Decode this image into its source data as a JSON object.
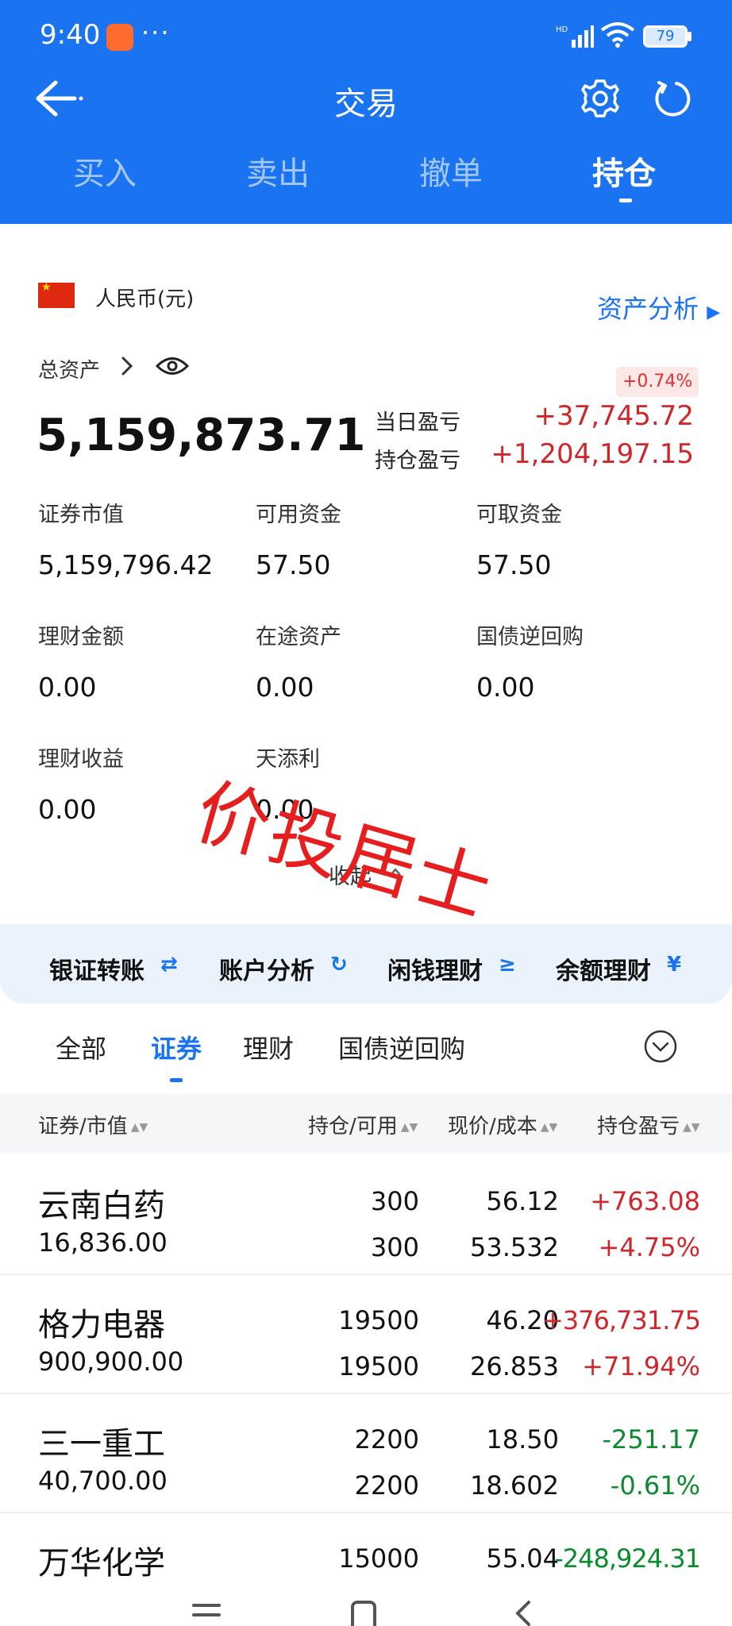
{
  "status_bar": {
    "time": "9:40",
    "dots": "···",
    "battery": "79"
  },
  "nav": {
    "title": "交易"
  },
  "tabs": [
    {
      "label": "买入"
    },
    {
      "label": "卖出"
    },
    {
      "label": "撤单"
    },
    {
      "label": "持仓",
      "active": true
    }
  ],
  "account": {
    "currency": "人民币(元)",
    "asset_analysis": "资产分析",
    "total_label": "总资产",
    "total_value": "5,159,873.71",
    "pct_badge": "+0.74%",
    "daily_pl_label": "当日盈亏",
    "daily_pl_value": "+37,745.72",
    "hold_pl_label": "持仓盈亏",
    "hold_pl_value": "+1,204,197.15",
    "grid": [
      {
        "label": "证券市值",
        "value": "5,159,796.42"
      },
      {
        "label": "可用资金",
        "value": "57.50"
      },
      {
        "label": "可取资金",
        "value": "57.50"
      },
      {
        "label": "理财金额",
        "value": "0.00"
      },
      {
        "label": "在途资产",
        "value": "0.00"
      },
      {
        "label": "国债逆回购",
        "value": "0.00"
      },
      {
        "label": "理财收益",
        "value": "0.00"
      },
      {
        "label": "天添利",
        "value": "0.00"
      }
    ],
    "collapse": "收起",
    "watermark": "价投居士"
  },
  "quick_actions": [
    {
      "label": "银证转账",
      "icon": "⇄"
    },
    {
      "label": "账户分析",
      "icon": "↻"
    },
    {
      "label": "闲钱理财",
      "icon": "≥"
    },
    {
      "label": "余额理财",
      "icon": "¥"
    }
  ],
  "filter_tabs": [
    {
      "label": "全部"
    },
    {
      "label": "证券",
      "active": true
    },
    {
      "label": "理财"
    },
    {
      "label": "国债逆回购"
    }
  ],
  "table_header": {
    "col1": "证券/市值",
    "col2": "持仓/可用",
    "col3": "现价/成本",
    "col4": "持仓盈亏",
    "sort_glyph": "▲▼"
  },
  "rows": [
    {
      "name": "云南白药",
      "market_value": "16,836.00",
      "holding": "300",
      "available": "300",
      "price": "56.12",
      "cost": "53.532",
      "pl": "+763.08",
      "pl_pct": "+4.75%",
      "positive": true
    },
    {
      "name": "格力电器",
      "market_value": "900,900.00",
      "holding": "19500",
      "available": "19500",
      "price": "46.20",
      "cost": "26.853",
      "pl": "+376,731.75",
      "pl_pct": "+71.94%",
      "positive": true
    },
    {
      "name": "三一重工",
      "market_value": "40,700.00",
      "holding": "2200",
      "available": "2200",
      "price": "18.50",
      "cost": "18.602",
      "pl": "-251.17",
      "pl_pct": "-0.61%",
      "positive": false
    },
    {
      "name": "万华化学",
      "market_value": "",
      "holding": "15000",
      "available": "",
      "price": "55.04",
      "cost": "",
      "pl": "-248,924.31",
      "pl_pct": "",
      "positive": false
    }
  ]
}
